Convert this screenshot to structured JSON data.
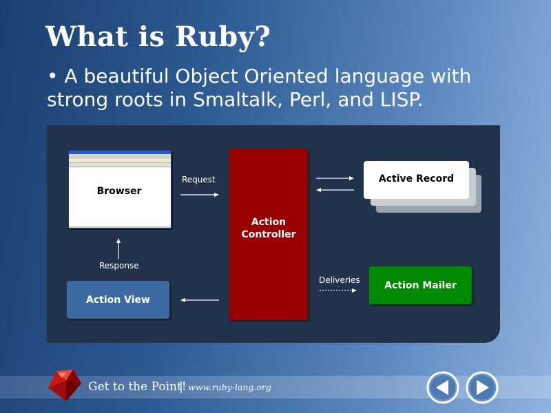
{
  "slide": {
    "title": "What is Ruby?",
    "bullet": "• A beautiful Object Oriented language with strong roots in Smaltalk, Perl, and LISP."
  },
  "diagram": {
    "nodes": {
      "browser": "Browser",
      "controller_line1": "Action",
      "controller_line2": "Controller",
      "active_record": "Active Record",
      "action_mailer": "Action Mailer",
      "action_view": "Action View"
    },
    "edges": {
      "request": "Request",
      "response": "Response",
      "deliveries": "Deliveries"
    },
    "colors": {
      "panel": "#22324a",
      "controller": "#990000",
      "mailer": "#008a00",
      "view": "#3d6aa3"
    }
  },
  "footer": {
    "tagline": "Get to the Point!",
    "separator": "|",
    "url": "www.ruby-lang.org",
    "logo_icon": "ruby-gem-icon",
    "prev_icon": "previous-arrow-icon",
    "next_icon": "next-arrow-icon"
  }
}
